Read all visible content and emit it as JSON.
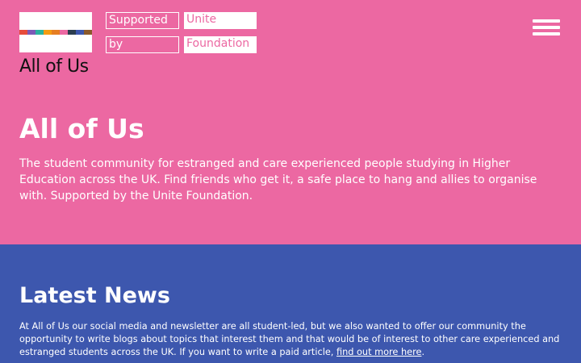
{
  "header": {
    "logo_text": "All of Us",
    "logo_stripe_colors": [
      "#e74c3c",
      "#7c5ab8",
      "#2ab3a0",
      "#f39c12",
      "#e67e22",
      "#ec68a2",
      "#2c3e50",
      "#3d57ae",
      "#8b5a2b"
    ],
    "sponsor": {
      "word1": "Supported",
      "word2": "Unite",
      "word3": "by",
      "word4": "Foundation"
    },
    "menu_icon": "hamburger-menu-icon"
  },
  "hero": {
    "title": "All of Us",
    "description": "The student community for estranged and care experienced people studying in Higher Education across the UK. Find friends who get it, a safe place to hang and allies to organise with. Supported by the Unite Foundation."
  },
  "news": {
    "title": "Latest News",
    "description_prefix": "At All of Us our social media and newsletter are all student-led, but we also wanted to offer our community the opportunity to write blogs about topics that interest them and that would be of interest to other care experienced and estranged students across the UK. If you want to write a paid article, ",
    "link_text": "find out more here",
    "description_suffix": "."
  },
  "colors": {
    "hero_background": "#ec68a2",
    "news_background": "#3d57ae",
    "text": "#ffffff"
  }
}
